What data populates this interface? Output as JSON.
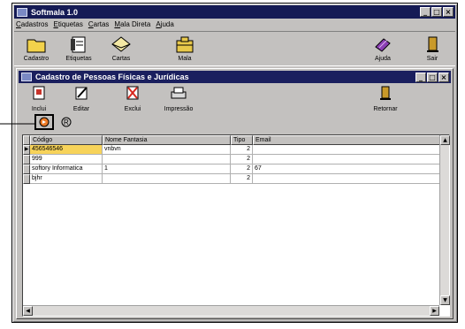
{
  "main": {
    "title": "Softmala 1.0",
    "menu": [
      "Cadastros",
      "Etiquetas",
      "Cartas",
      "Mala Direta",
      "Ajuda"
    ],
    "tools": [
      "Cadastro",
      "Etiquetas",
      "Cartas",
      "Mala",
      "Ajuda",
      "Sair"
    ],
    "window_buttons": [
      "_",
      "□",
      "×"
    ]
  },
  "child": {
    "title": "Cadastro de Pessoas Físicas e Jurídicas",
    "tools": [
      "Inclui",
      "Editar",
      "Exclui",
      "Impressão",
      "Retornar"
    ],
    "window_buttons": [
      "_",
      "□",
      "×"
    ]
  },
  "grid": {
    "columns": [
      "Código",
      "Nome Fantasia",
      "Tipo",
      "Email"
    ],
    "rows": [
      [
        "456546546",
        "vnbvn",
        "2",
        ""
      ],
      [
        "999",
        "",
        "2",
        ""
      ],
      [
        "softory Informatica",
        "1",
        "2",
        "67"
      ],
      [
        "bjhr",
        "",
        "2",
        ""
      ]
    ]
  },
  "colors": {
    "titlebar": "#151b55",
    "selected_cell": "#f7d35a",
    "window": "#c3c1bf"
  }
}
